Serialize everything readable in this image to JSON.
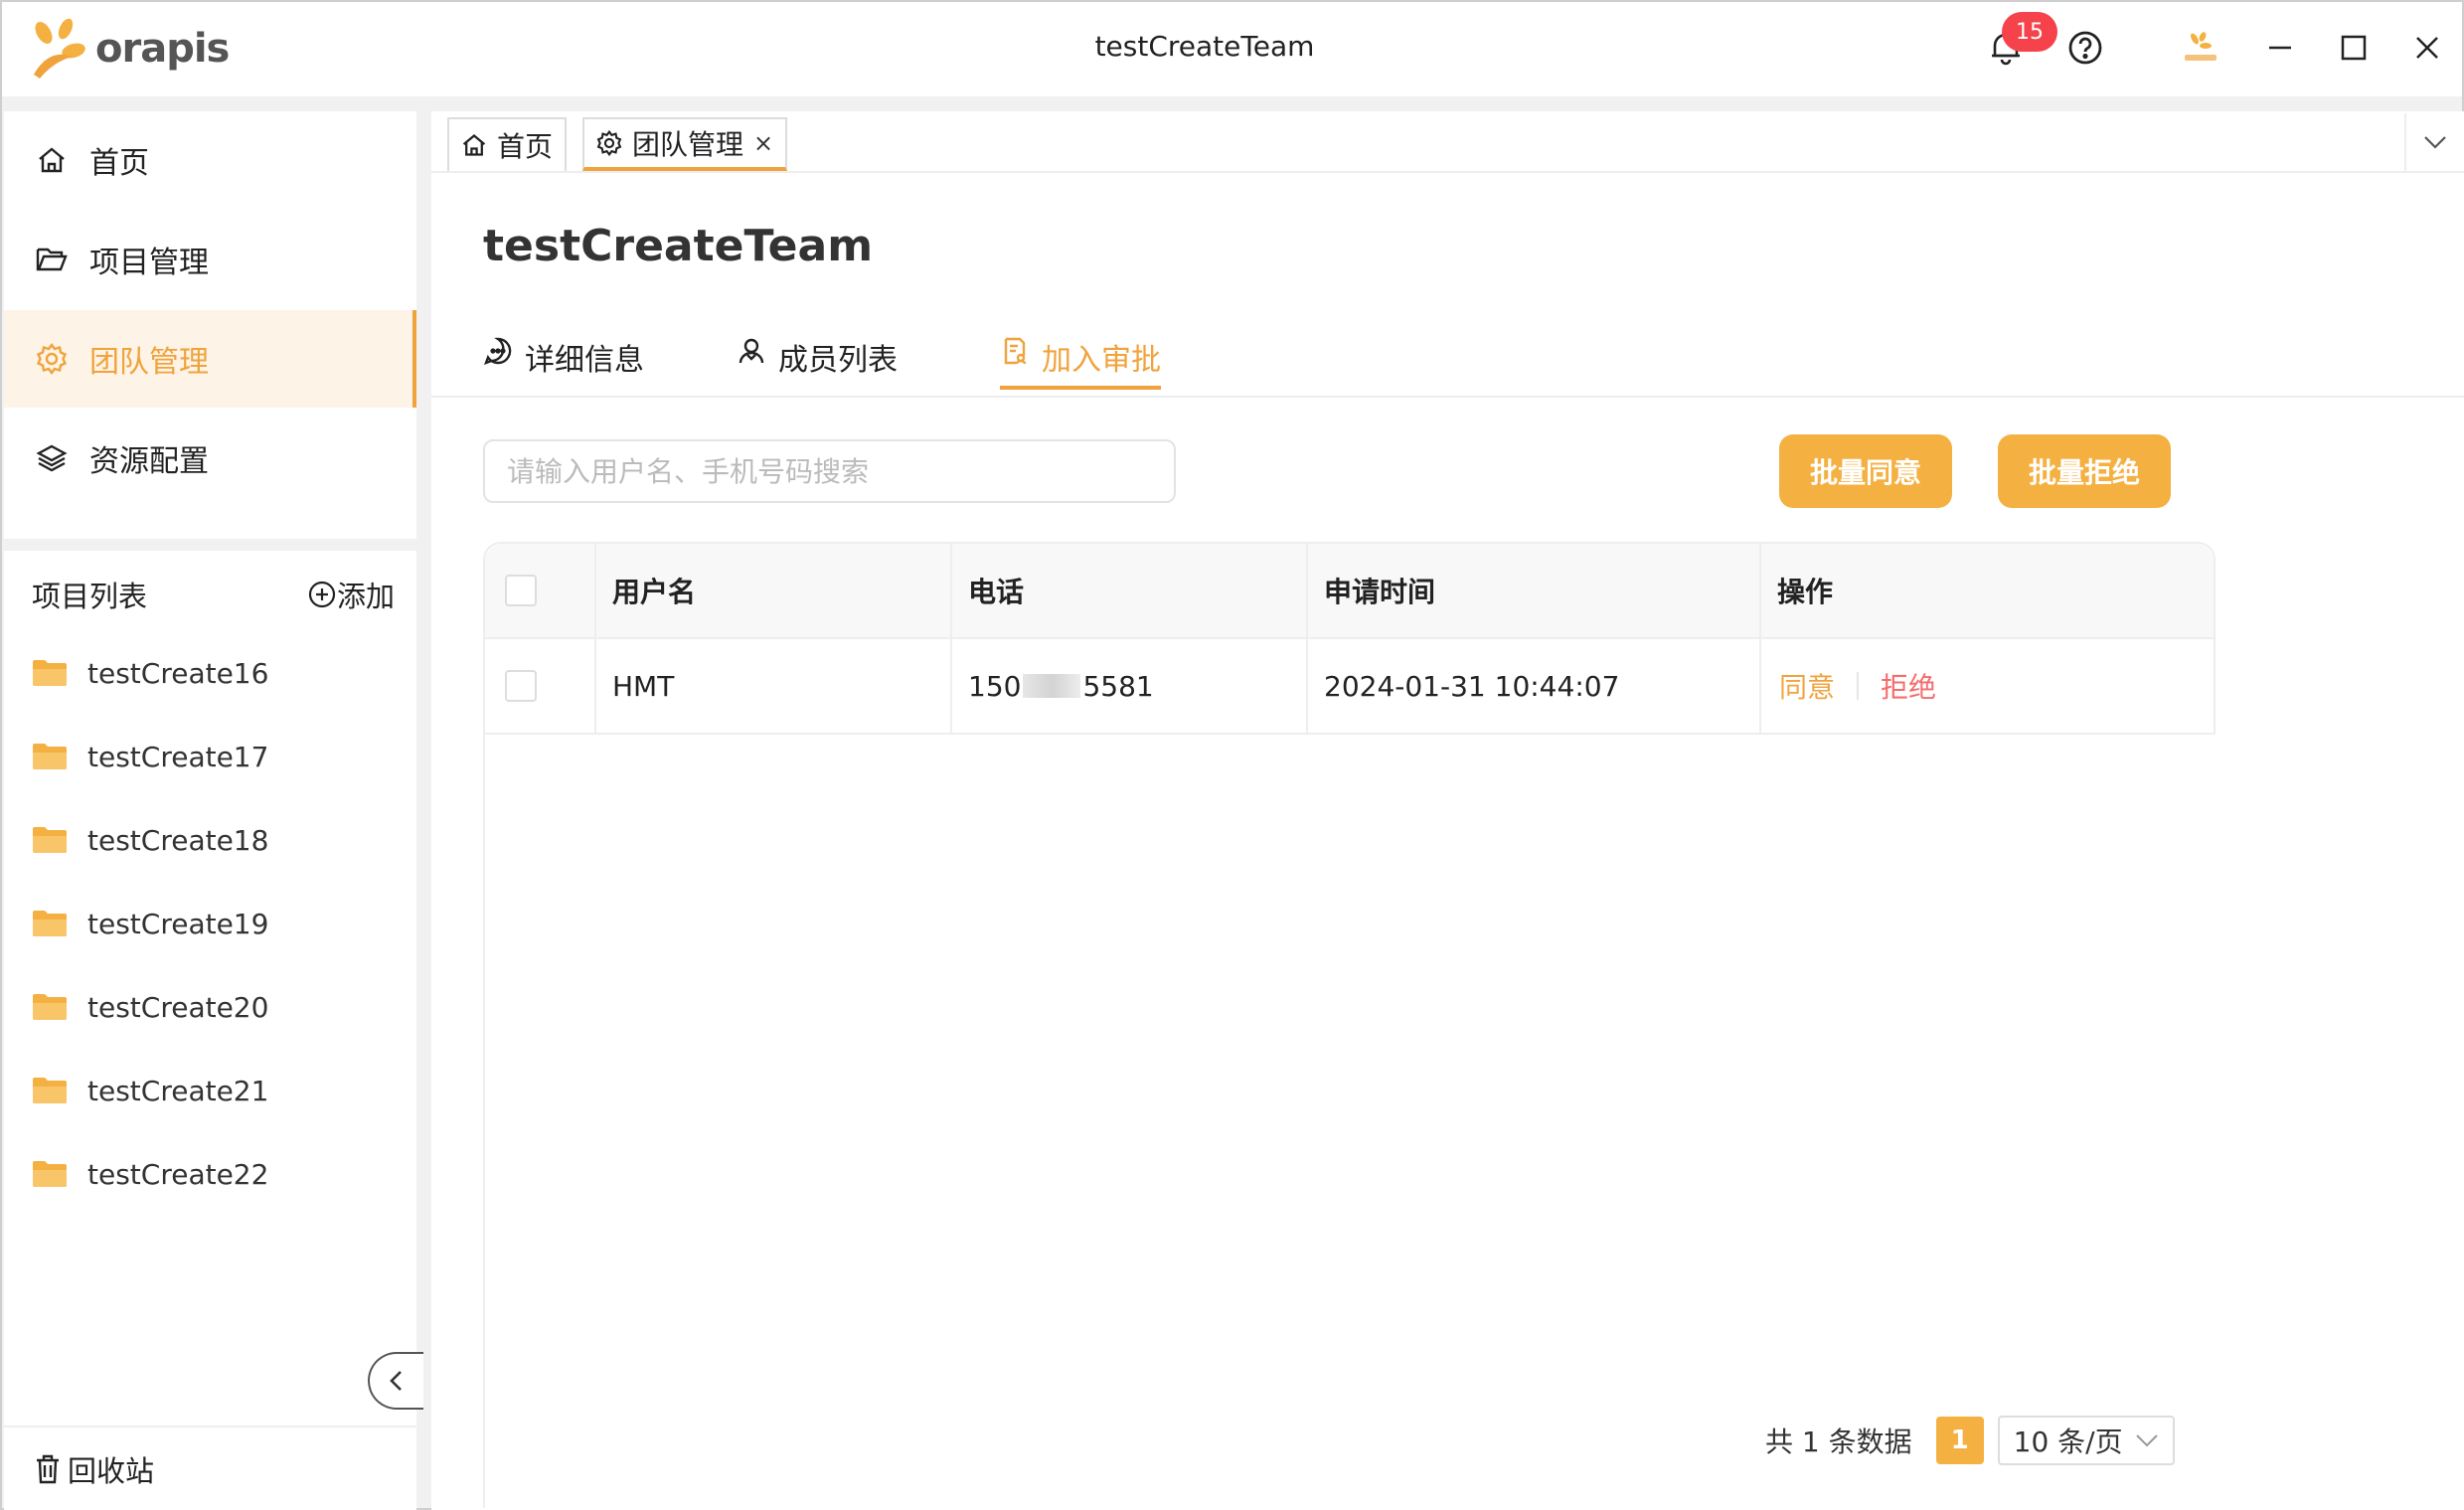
{
  "window": {
    "title": "testCreateTeam",
    "logo_text": "orapis",
    "notification_count": "15"
  },
  "sidebar": {
    "nav": [
      {
        "label": "首页",
        "icon": "home-icon"
      },
      {
        "label": "项目管理",
        "icon": "folder-open-icon"
      },
      {
        "label": "团队管理",
        "icon": "gear-icon"
      },
      {
        "label": "资源配置",
        "icon": "layers-icon"
      }
    ],
    "project_list_label": "项目列表",
    "add_label": "添加",
    "projects": [
      "testCreate16",
      "testCreate17",
      "testCreate18",
      "testCreate19",
      "testCreate20",
      "testCreate21",
      "testCreate22"
    ],
    "recycle_label": "回收站"
  },
  "page_tabs": [
    {
      "label": "首页",
      "icon": "home-icon"
    },
    {
      "label": "团队管理",
      "icon": "gear-icon",
      "close": "×"
    }
  ],
  "team": {
    "title": "testCreateTeam",
    "tabs": [
      {
        "label": "详细信息",
        "icon": "chat-icon"
      },
      {
        "label": "成员列表",
        "icon": "user-icon"
      },
      {
        "label": "加入审批",
        "icon": "approval-icon"
      }
    ],
    "active_tab": 2
  },
  "approval": {
    "search_placeholder": "请输入用户名、手机号码搜索",
    "batch_agree": "批量同意",
    "batch_reject": "批量拒绝",
    "columns": [
      "用户名",
      "电话",
      "申请时间",
      "操作"
    ],
    "rows": [
      {
        "username": "HMT",
        "phone_prefix": "150",
        "phone_suffix": "5581",
        "time": "2024-01-31 10:44:07",
        "agree": "同意",
        "reject": "拒绝"
      }
    ]
  },
  "pagination": {
    "total_text": "共 1 条数据",
    "current_page": "1",
    "page_size": "10 条/页"
  },
  "colors": {
    "accent": "#f0a33c",
    "button": "#f4b142",
    "reject": "#f56c6c",
    "badge": "#f5424b"
  }
}
